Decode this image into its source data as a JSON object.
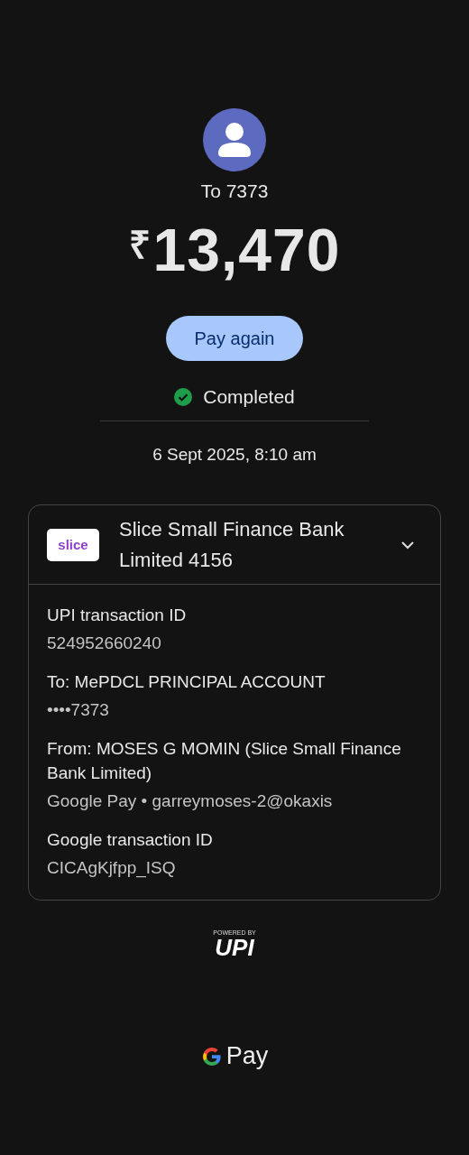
{
  "recipient": {
    "label": "To 7373"
  },
  "amount": {
    "currency": "₹",
    "value": "13,470"
  },
  "pay_again_button": "Pay again",
  "status": {
    "label": "Completed",
    "kind": "success"
  },
  "datetime": "6 Sept 2025, 8:10 am",
  "account_card": {
    "bank_logo": "slice",
    "bank_name": "Slice Small Finance Bank Limited 4156",
    "details": [
      {
        "label": "UPI transaction ID",
        "value": "524952660240"
      },
      {
        "label": "To: MePDCL PRINCIPAL ACCOUNT",
        "value": "••••7373"
      },
      {
        "label": "From: MOSES G MOMIN (Slice Small Finance Bank Limited)",
        "value": "Google Pay • garreymoses-2@okaxis"
      },
      {
        "label": "Google transaction ID",
        "value": "CICAgKjfpp_ISQ"
      }
    ]
  },
  "upi_badge": {
    "caption": "POWERED BY",
    "logo": "UPI"
  },
  "footer_brand": "Pay"
}
